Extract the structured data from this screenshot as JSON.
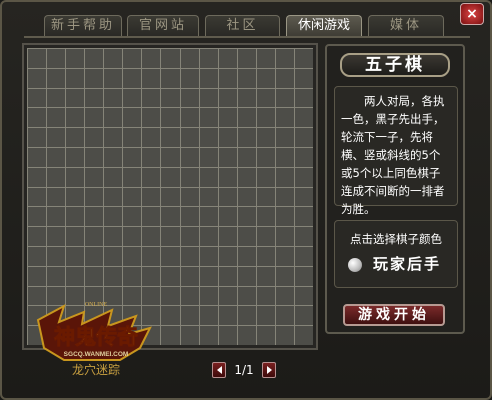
{
  "tabs": [
    {
      "label": "新手帮助",
      "active": false
    },
    {
      "label": "官网站",
      "active": false
    },
    {
      "label": "社区",
      "active": false
    },
    {
      "label": "休闲游戏",
      "active": true
    },
    {
      "label": "媒体",
      "active": false
    }
  ],
  "close_icon": "×",
  "board": {
    "cols": 15,
    "rows": 15,
    "grid_color": "#858478",
    "background_color": "#4d4d48"
  },
  "panel": {
    "title": "五子棋",
    "description": "两人对局，各执一色，黑子先出手，轮流下一子，先将横、竖或斜线的5个或5个以上同色棋子连成不间断的一排者为胜。",
    "choose_color_label": "点击选择棋子颜色",
    "player_order": "玩家后手",
    "start_button": "游戏开始"
  },
  "logo": {
    "online": "ONLINE",
    "name": "神鬼传奇",
    "site": "SGCQ.WANMEI.COM",
    "subtitle": "龙穴迷踪"
  },
  "pager": {
    "page": "1/1"
  }
}
